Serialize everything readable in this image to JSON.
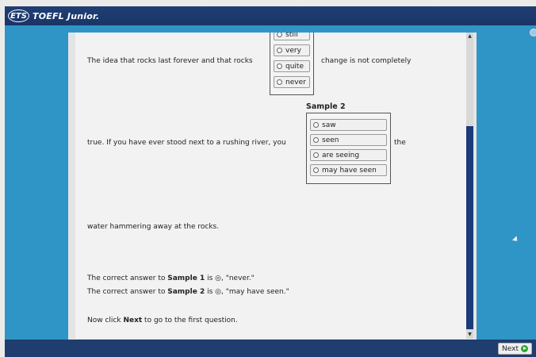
{
  "header": {
    "logo_mark": "ETS",
    "brand": "TOEFL Junior."
  },
  "passage": {
    "line1_before": "The idea that rocks last forever and that rocks",
    "line1_after": "change is not completely",
    "line2_before": "true. If you have ever stood next to a rushing river, you",
    "line2_after": "the",
    "line3": "water hammering away at the rocks."
  },
  "sample1": {
    "options": [
      "still",
      "very",
      "quite",
      "never"
    ]
  },
  "sample2": {
    "label": "Sample 2",
    "options": [
      "saw",
      "seen",
      "are seeing",
      "may have seen"
    ]
  },
  "answers": {
    "a1_prefix": "The correct answer to ",
    "a1_bold": "Sample 1",
    "a1_suffix": " is ◎, \"never.\"",
    "a2_prefix": "The correct answer to ",
    "a2_bold": "Sample 2",
    "a2_suffix": " is ◎, \"may have seen.\""
  },
  "instruction": {
    "prefix": "Now click ",
    "bold": "Next",
    "suffix": " to go to the first question."
  },
  "footer": {
    "next_label": "Next"
  },
  "colors": {
    "header": "#1f3f74",
    "background": "#2f95c6",
    "scroll_thumb": "#1b3a78",
    "next_icon": "#2fa52f"
  }
}
